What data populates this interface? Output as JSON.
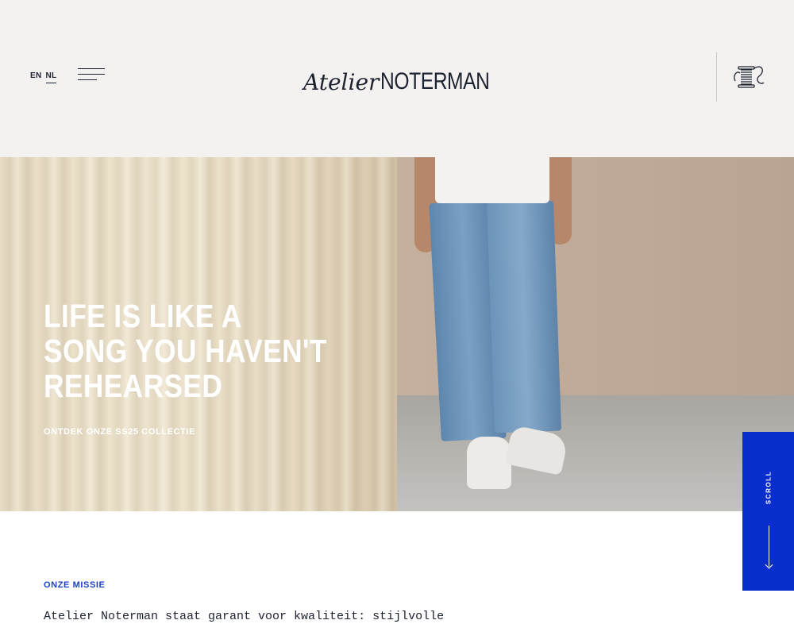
{
  "header": {
    "languages": [
      {
        "label": "EN",
        "active": false
      },
      {
        "label": "NL",
        "active": true
      }
    ],
    "logo": {
      "script": "Atelier",
      "word": "NOTERMAN"
    },
    "menu_icon": "hamburger-menu-icon",
    "cart_icon": "thread-spool-icon"
  },
  "hero": {
    "headline_lines": [
      "LIFE IS LIKE A",
      "SONG YOU HAVEN'T",
      "REHEARSED"
    ],
    "cta": "ONTDEK ONZE SS25 COLLECTIE"
  },
  "scroll": {
    "label": "SCROLL",
    "icon": "arrow-down-icon",
    "color": "#0a2ecd"
  },
  "mission": {
    "label": "ONZE MISSIE",
    "text": "Atelier Noterman staat garant voor kwaliteit: stijlvolle"
  },
  "colors": {
    "accent": "#0a2ecd",
    "ink": "#1d2230",
    "header_bg": "#f3f2f0"
  }
}
